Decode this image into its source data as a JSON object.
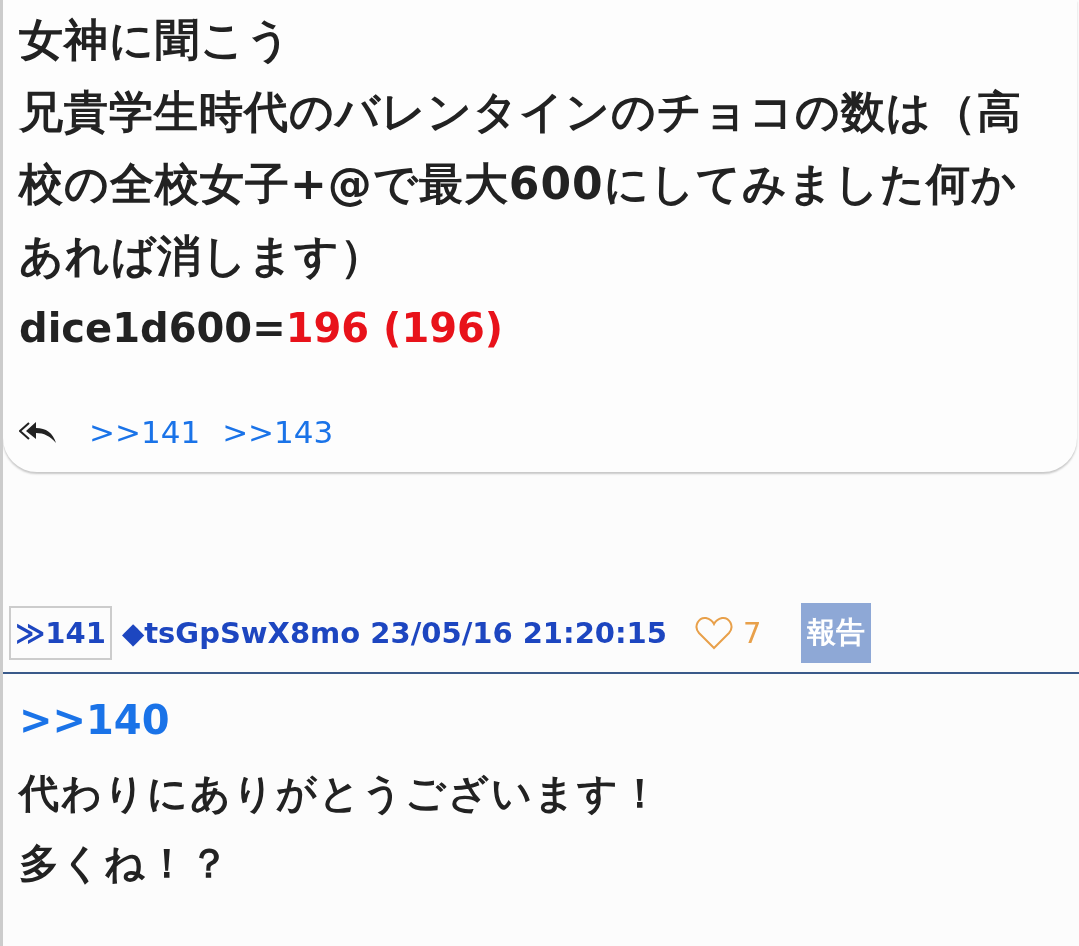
{
  "post_top": {
    "lines": [
      "女神に聞こう",
      "兄貴学生時代のバレンタインのチョコの数は（高校の全校女子+@で最大600にしてみました何かあれば消します）"
    ],
    "dice": {
      "expression": "dice1d600=",
      "result": "196 (196)"
    },
    "replies": [
      ">>141",
      ">>143"
    ]
  },
  "post": {
    "number": "≫141",
    "author": "◆tsGpSwX8mo 23/05/16 21:20:15",
    "likes": "7",
    "report": "報告",
    "anchor": ">>140",
    "lines": [
      "代わりにありがとうございます！",
      "多くね！？"
    ]
  }
}
